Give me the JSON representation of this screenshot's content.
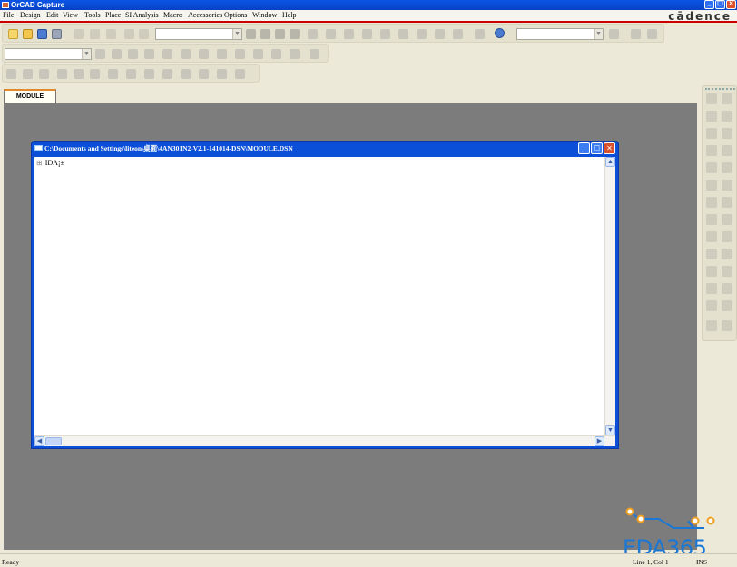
{
  "app": {
    "title": "OrCAD Capture",
    "brand": "cādence"
  },
  "menu": [
    "File",
    "Design",
    "Edit",
    "View",
    "Tools",
    "Place",
    "SI Analysis",
    "Macro",
    "Accessories",
    "Options",
    "Window",
    "Help"
  ],
  "tabs": [
    {
      "label": "MODULE"
    }
  ],
  "document": {
    "title": "C:\\Documents and Settings\\liteon\\桌面\\4AN301N2-V2.1-141014-DSN\\MODULE.DSN",
    "tree_item": "IDA¡±"
  },
  "status": {
    "text": "Ready",
    "position": "Line 1, Col 1",
    "mode": "INS"
  },
  "watermark": {
    "text": "EDA365"
  },
  "colors": {
    "accent": "#e08a2c",
    "titlebar": "#0a55e6",
    "workspace": "#7c7c7c",
    "brand_line": "#cc0000"
  }
}
